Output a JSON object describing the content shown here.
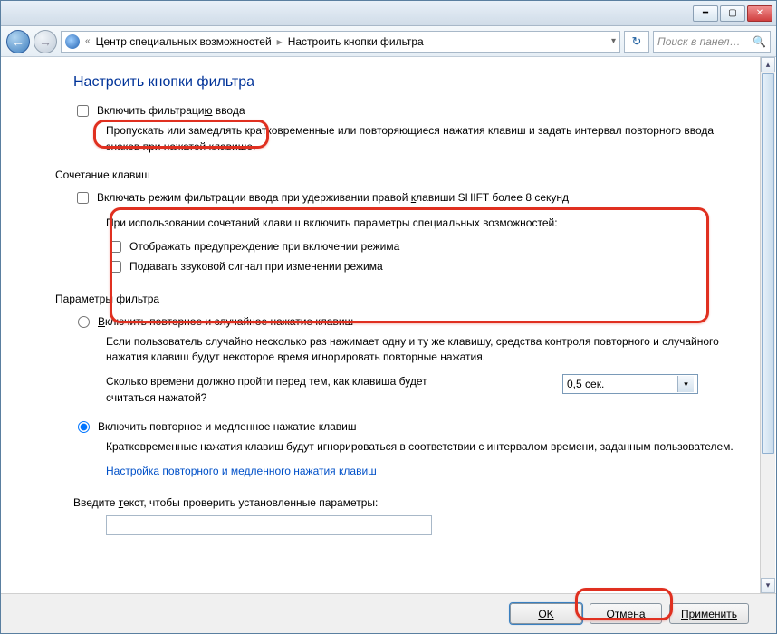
{
  "titlebar": {
    "minimize_glyph": "━",
    "maximize_glyph": "▢",
    "close_glyph": "✕"
  },
  "nav": {
    "back_glyph": "←",
    "fwd_glyph": "→",
    "bc_left_chev": "«",
    "bc1": "Центр специальных возможностей",
    "bc_sep": "▸",
    "bc2": "Настроить кнопки фильтра",
    "dd_glyph": "▾",
    "refresh_glyph": "↻",
    "search_placeholder": "Поиск в панел…",
    "search_icon": "🔍"
  },
  "page": {
    "title": "Настроить кнопки фильтра",
    "cb_enable": "Включить фильтраци",
    "cb_enable_u": "ю",
    "cb_enable_suffix": " ввода",
    "desc_enable": "Пропускать или замедлять кратковременные или повторяющиеся нажатия клавиш и задать интервал повторного ввода знаков при нажатой клавише.",
    "section_shortcut": "Сочетание клавиш",
    "cb_shift_a": "Включать режим фильтрации ввода при удерживании правой ",
    "cb_shift_u": "к",
    "cb_shift_b": "лавиши SHIFT более 8 секунд",
    "sub_heading": "При использовании сочетаний клавиш включить параметры специальных возможностей:",
    "cb_warn": "Отображать предупреждение при включении режима",
    "cb_sound": "Подавать звуковой сигнал при изменении режима",
    "section_filter": "Параметры фильтра",
    "rb_bounce_u": "В",
    "rb_bounce": "ключить повторное и случайное нажатие клавиш",
    "desc_bounce": "Если пользователь случайно несколько раз нажимает одну и ту же клавишу, средства контроля повторного и случайного нажатия клавиш будут некоторое время игнорировать повторные нажатия.",
    "q_bounce": "Сколько времени должно пройти перед тем, как клавиша будет считаться нажатой?",
    "dd_value": "0,5 сек.",
    "rb_slow": "Включить повторное и медленное нажатие клавиш",
    "desc_slow": "Кратковременные нажатия клавиш будут игнорироваться в соответствии с интервалом времени, заданным пользователем.",
    "link_slow": "Настройка повторного и медленного нажатия клавиш",
    "test_label_a": "Введите ",
    "test_label_u": "т",
    "test_label_b": "екст, чтобы проверить установленные параметры:"
  },
  "footer": {
    "ok": "OK",
    "cancel": "Отмена",
    "apply": "Применить"
  },
  "scroll": {
    "up": "▴",
    "down": "▾"
  }
}
